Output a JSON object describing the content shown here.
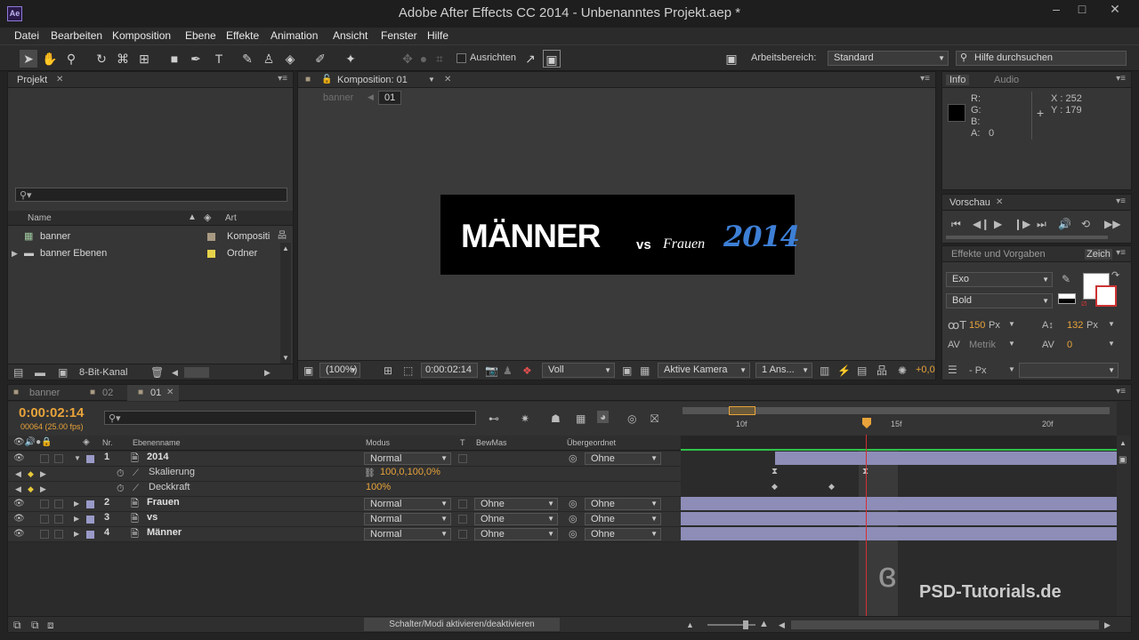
{
  "window": {
    "title": "Adobe After Effects CC 2014 - Unbenanntes Projekt.aep *",
    "logo": "Ae"
  },
  "menu": [
    "Datei",
    "Bearbeiten",
    "Komposition",
    "Ebene",
    "Effekte",
    "Animation",
    "Ansicht",
    "Fenster",
    "Hilfe"
  ],
  "toolbar": {
    "snap_label": "Ausrichten",
    "workspace_label": "Arbeitsbereich:",
    "workspace_value": "Standard",
    "search_placeholder": "Hilfe durchsuchen"
  },
  "project": {
    "tab": "Projekt",
    "col_name": "Name",
    "col_type": "Art",
    "items": [
      {
        "name": "banner",
        "type": "Kompositi",
        "color": "#a89a82"
      },
      {
        "name": "banner Ebenen",
        "type": "Ordner",
        "color": "#e6d24a"
      }
    ],
    "bit_depth": "8-Bit-Kanal"
  },
  "comp": {
    "tab": "Komposition: 01",
    "breadcrumb_parent": "banner",
    "breadcrumb_current": "01",
    "zoom": "(100%)",
    "time": "0:00:02:14",
    "resolution": "Voll",
    "camera": "Aktive Kamera",
    "views": "1 Ans...",
    "exposure": "+0,0"
  },
  "banner": {
    "word1": "MÄNNER",
    "word2": "vs",
    "word3": "Frauen",
    "year": "2014"
  },
  "info": {
    "tab": "Info",
    "tab2": "Audio",
    "r": "R:",
    "g": "G:",
    "b": "B:",
    "a": "A:",
    "a_value": "0",
    "x": "X : 252",
    "y": "Y : 179"
  },
  "preview": {
    "tab": "Vorschau"
  },
  "effects": {
    "tab": "Effekte und Vorgaben",
    "tab2": "Zeich",
    "font": "Exo",
    "style": "Bold",
    "size": "150",
    "size_unit": "Px",
    "leading": "132",
    "leading_unit": "Px",
    "kerning": "Metrik",
    "tracking": "0",
    "stroke_unit": "- Px"
  },
  "timeline": {
    "tabs": [
      "banner",
      "02",
      "01"
    ],
    "timecode": "0:00:02:14",
    "frameinfo": "00064 (25.00 fps)",
    "cols": {
      "nr": "Nr.",
      "name": "Ebenenname",
      "mode": "Modus",
      "t": "T",
      "trkmat": "BewMas",
      "parent": "Übergeordnet"
    },
    "layers": [
      {
        "nr": "1",
        "name": "2014",
        "mode": "Normal",
        "parent": "Ohne",
        "trkmat": ""
      },
      {
        "nr": "2",
        "name": "Frauen",
        "mode": "Normal",
        "parent": "Ohne",
        "trkmat": "Ohne"
      },
      {
        "nr": "3",
        "name": "vs",
        "mode": "Normal",
        "parent": "Ohne",
        "trkmat": "Ohne"
      },
      {
        "nr": "4",
        "name": "Männer",
        "mode": "Normal",
        "parent": "Ohne",
        "trkmat": "Ohne"
      }
    ],
    "props": [
      {
        "name": "Skalierung",
        "value": "100,0,100,0%"
      },
      {
        "name": "Deckkraft",
        "value": "100%"
      }
    ],
    "ruler": [
      "10f",
      "15f",
      "20f"
    ],
    "toggle_label": "Schalter/Modi aktivieren/deaktivieren"
  },
  "watermark": "PSD-Tutorials.de",
  "colors": {
    "accent": "#e8a33a",
    "layer_bar": "#8d8db8",
    "playhead": "#d63030"
  }
}
